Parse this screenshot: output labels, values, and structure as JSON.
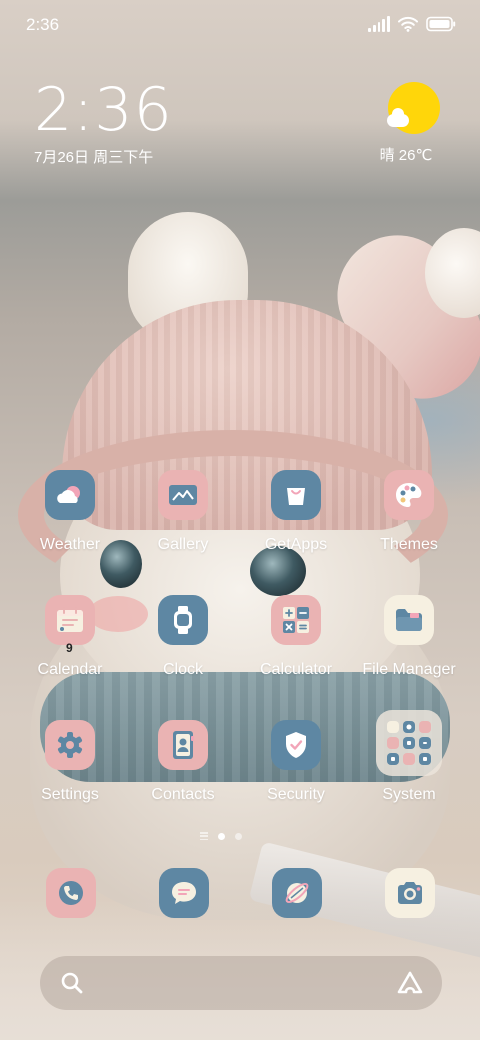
{
  "status_bar": {
    "time": "2:36",
    "icons": [
      "signal-icon",
      "wifi-icon",
      "battery-icon"
    ]
  },
  "clock_widget": {
    "time": "2:36",
    "date": "7月26日 周三下午"
  },
  "weather_widget": {
    "icon": "partly-sunny-icon",
    "text": "晴 26℃"
  },
  "apps": [
    {
      "name": "weather",
      "label": "Weather",
      "bg": "#5e87a3",
      "icon": "weather-icon"
    },
    {
      "name": "gallery",
      "label": "Gallery",
      "bg": "#eab3b3",
      "icon": "gallery-icon"
    },
    {
      "name": "getapps",
      "label": "GetApps",
      "bg": "#5e87a3",
      "icon": "shopping-bag-icon"
    },
    {
      "name": "themes",
      "label": "Themes",
      "bg": "#eab3b3",
      "icon": "palette-icon"
    },
    {
      "name": "calendar",
      "label": "Calendar",
      "bg": "#eab3b3",
      "icon": "calendar-icon",
      "badge": "9"
    },
    {
      "name": "clock",
      "label": "Clock",
      "bg": "#5e87a3",
      "icon": "watch-icon"
    },
    {
      "name": "calculator",
      "label": "Calculator",
      "bg": "#eab3b3",
      "icon": "calculator-icon"
    },
    {
      "name": "file-manager",
      "label": "File Manager",
      "bg": "#f6f0e1",
      "icon": "folder-icon"
    },
    {
      "name": "settings",
      "label": "Settings",
      "bg": "#eab3b3",
      "icon": "gear-icon"
    },
    {
      "name": "contacts",
      "label": "Contacts",
      "bg": "#eab3b3",
      "icon": "contacts-book-icon"
    },
    {
      "name": "security",
      "label": "Security",
      "bg": "#5e87a3",
      "icon": "shield-icon"
    },
    {
      "name": "system",
      "label": "System",
      "bg": "#e7e0d6",
      "icon": "folder-grid-icon"
    }
  ],
  "page_indicator": {
    "pages": 3,
    "active": 2
  },
  "dock": [
    {
      "name": "phone",
      "bg": "#eab3b3",
      "icon": "phone-icon"
    },
    {
      "name": "messages",
      "bg": "#5e87a3",
      "icon": "message-bubble-icon"
    },
    {
      "name": "browser",
      "bg": "#5e87a3",
      "icon": "globe-icon"
    },
    {
      "name": "camera",
      "bg": "#f6f0e1",
      "icon": "camera-icon"
    }
  ],
  "search_bar": {
    "icons": [
      "search-icon",
      "assistant-icon"
    ]
  },
  "colors": {
    "blue_icon": "#5e87a3",
    "pink_icon": "#eab3b3",
    "cream_icon": "#f6f0e1",
    "sun": "#ffd60a"
  }
}
